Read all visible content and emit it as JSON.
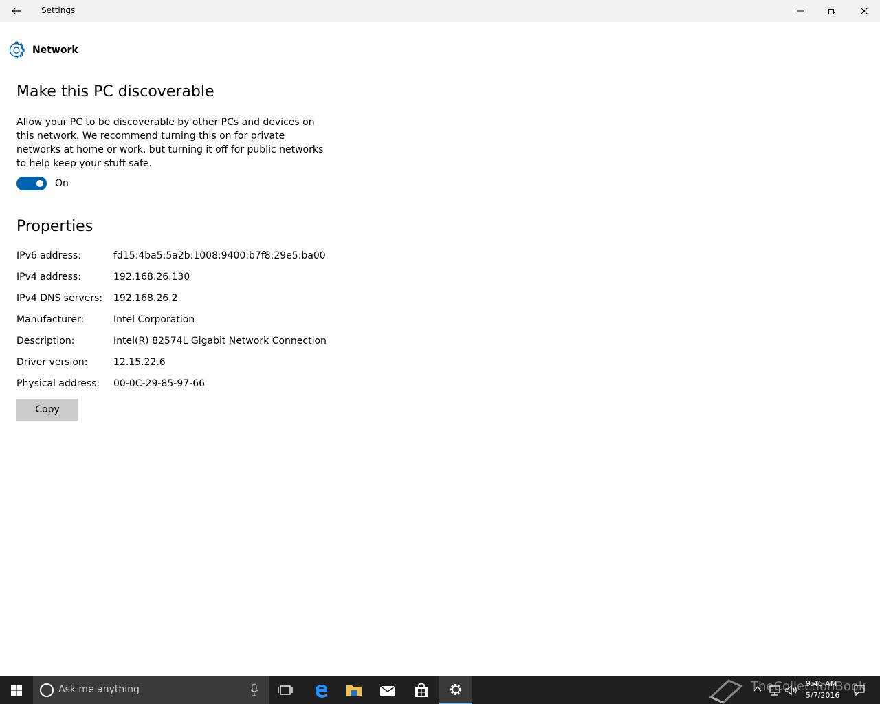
{
  "window": {
    "title": "Settings"
  },
  "header": {
    "title": "Network",
    "icon": "gear-icon"
  },
  "discoverable": {
    "heading": "Make this PC discoverable",
    "description": "Allow your PC to be discoverable by other PCs and devices on this network. We recommend turning this on for private networks at home or work, but turning it off for public networks to help keep your stuff safe.",
    "toggle_state": "On"
  },
  "properties": {
    "heading": "Properties",
    "rows": [
      {
        "label": "IPv6 address:",
        "value": "fd15:4ba5:5a2b:1008:9400:b7f8:29e5:ba00"
      },
      {
        "label": "IPv4 address:",
        "value": "192.168.26.130"
      },
      {
        "label": "IPv4 DNS servers:",
        "value": "192.168.26.2"
      },
      {
        "label": "Manufacturer:",
        "value": "Intel Corporation"
      },
      {
        "label": "Description:",
        "value": "Intel(R) 82574L Gigabit Network Connection"
      },
      {
        "label": "Driver version:",
        "value": "12.15.22.6"
      },
      {
        "label": "Physical address:",
        "value": "00-0C-29-85-97-66"
      }
    ],
    "copy_label": "Copy"
  },
  "taskbar": {
    "search_placeholder": "Ask me anything",
    "time": "9:46 AM",
    "date": "5/7/2016",
    "watermark": "TheCollectionBook"
  },
  "colors": {
    "accent": "#0063b1",
    "titlebar": "#f2f2f2",
    "taskbar": "#1f1f1f",
    "button": "#cccccc"
  }
}
